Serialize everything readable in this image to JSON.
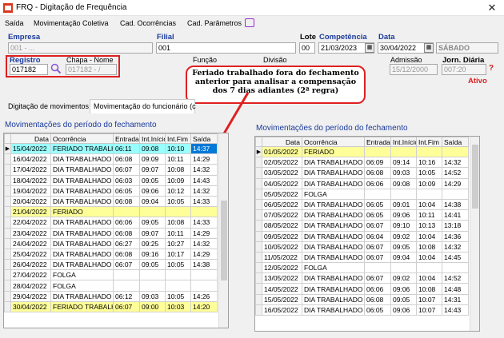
{
  "window": {
    "title": "FRQ - Digitação de Frequência",
    "close": "✕"
  },
  "menu": [
    "Saída",
    "Movimentação Coletiva",
    "Cad. Ocorrências",
    "Cad. Parâmetros"
  ],
  "header": {
    "empresa_label": "Empresa",
    "empresa_value": "001 - ...",
    "filial_label": "Filial",
    "filial_value": "001",
    "lote_label": "Lote",
    "lote_value": "00",
    "competencia_label": "Competência",
    "competencia_value": "21/03/2023",
    "data_label": "Data",
    "data_value": "30/04/2022",
    "dia_semana": "SÁBADO",
    "registro_label": "Registro",
    "registro_value": "017182",
    "chapa_label": "Chapa - Nome",
    "chapa_value": "017182 - /",
    "funcao_label": "Função",
    "divisao_label": "Divisão",
    "admissao_label": "Admissão",
    "admissao_value": "15/12/2000",
    "jornada_label": "Jorn. Diária",
    "jornada_value": "007:20",
    "status": "Ativo",
    "help": "?"
  },
  "tabs": [
    "Digitação de movimentos",
    "Movimentação do funcionário (c"
  ],
  "callout": "Feriado trabalhado fora do fechamento anterior para analisar a compensação dos 7 dias adiantes (2ª regra)",
  "left_grid": {
    "title": "Movimentações do período do fechamento",
    "columns": [
      "Data",
      "Ocorrência",
      "Entrada",
      "Int.Início",
      "Int.Fim",
      "Saída"
    ],
    "rows": [
      {
        "data": "15/04/2022",
        "oc": "FERIADO TRABALH",
        "ent": "06:11",
        "ini": "09:08",
        "fim": "10:10",
        "sai": "14:37",
        "hl": "cyan"
      },
      {
        "data": "16/04/2022",
        "oc": "DIA TRABALHADO",
        "ent": "06:08",
        "ini": "09:09",
        "fim": "10:11",
        "sai": "14:29",
        "hl": ""
      },
      {
        "data": "17/04/2022",
        "oc": "DIA TRABALHADO",
        "ent": "06:07",
        "ini": "09:07",
        "fim": "10:08",
        "sai": "14:32",
        "hl": ""
      },
      {
        "data": "18/04/2022",
        "oc": "DIA TRABALHADO",
        "ent": "06:03",
        "ini": "09:05",
        "fim": "10:09",
        "sai": "14:43",
        "hl": ""
      },
      {
        "data": "19/04/2022",
        "oc": "DIA TRABALHADO",
        "ent": "06:05",
        "ini": "09:06",
        "fim": "10:12",
        "sai": "14:32",
        "hl": ""
      },
      {
        "data": "20/04/2022",
        "oc": "DIA TRABALHADO",
        "ent": "06:08",
        "ini": "09:04",
        "fim": "10:05",
        "sai": "14:33",
        "hl": ""
      },
      {
        "data": "21/04/2022",
        "oc": "FERIADO",
        "ent": "",
        "ini": "",
        "fim": "",
        "sai": "",
        "hl": "yellow"
      },
      {
        "data": "22/04/2022",
        "oc": "DIA TRABALHADO",
        "ent": "06:06",
        "ini": "09:05",
        "fim": "10:08",
        "sai": "14:33",
        "hl": ""
      },
      {
        "data": "23/04/2022",
        "oc": "DIA TRABALHADO",
        "ent": "06:08",
        "ini": "09:07",
        "fim": "10:11",
        "sai": "14:29",
        "hl": ""
      },
      {
        "data": "24/04/2022",
        "oc": "DIA TRABALHADO",
        "ent": "06:27",
        "ini": "09:25",
        "fim": "10:27",
        "sai": "14:32",
        "hl": ""
      },
      {
        "data": "25/04/2022",
        "oc": "DIA TRABALHADO",
        "ent": "06:08",
        "ini": "09:16",
        "fim": "10:17",
        "sai": "14:29",
        "hl": ""
      },
      {
        "data": "26/04/2022",
        "oc": "DIA TRABALHADO",
        "ent": "06:07",
        "ini": "09:05",
        "fim": "10:05",
        "sai": "14:38",
        "hl": ""
      },
      {
        "data": "27/04/2022",
        "oc": "FOLGA",
        "ent": "",
        "ini": "",
        "fim": "",
        "sai": "",
        "hl": ""
      },
      {
        "data": "28/04/2022",
        "oc": "FOLGA",
        "ent": "",
        "ini": "",
        "fim": "",
        "sai": "",
        "hl": ""
      },
      {
        "data": "29/04/2022",
        "oc": "DIA TRABALHADO",
        "ent": "06:12",
        "ini": "09:03",
        "fim": "10:05",
        "sai": "14:26",
        "hl": ""
      },
      {
        "data": "30/04/2022",
        "oc": "FERIADO TRABALH",
        "ent": "06:07",
        "ini": "09:00",
        "fim": "10:03",
        "sai": "14:20",
        "hl": "yellow"
      }
    ]
  },
  "right_grid": {
    "title": "Movimentações do período do fechamento",
    "columns": [
      "Data",
      "Ocorrência",
      "Entrada",
      "Int.Início",
      "Int.Fim",
      "Saída"
    ],
    "rows": [
      {
        "data": "01/05/2022",
        "oc": "FERIADO",
        "ent": "",
        "ini": "",
        "fim": "",
        "sai": "",
        "hl": "yellow"
      },
      {
        "data": "02/05/2022",
        "oc": "DIA TRABALHADO",
        "ent": "06:09",
        "ini": "09:14",
        "fim": "10:16",
        "sai": "14:32",
        "hl": ""
      },
      {
        "data": "03/05/2022",
        "oc": "DIA TRABALHADO",
        "ent": "06:08",
        "ini": "09:03",
        "fim": "10:05",
        "sai": "14:52",
        "hl": ""
      },
      {
        "data": "04/05/2022",
        "oc": "DIA TRABALHADO",
        "ent": "06:06",
        "ini": "09:08",
        "fim": "10:09",
        "sai": "14:29",
        "hl": ""
      },
      {
        "data": "05/05/2022",
        "oc": "FOLGA",
        "ent": "",
        "ini": "",
        "fim": "",
        "sai": "",
        "hl": ""
      },
      {
        "data": "06/05/2022",
        "oc": "DIA TRABALHADO",
        "ent": "06:05",
        "ini": "09:01",
        "fim": "10:04",
        "sai": "14:38",
        "hl": ""
      },
      {
        "data": "07/05/2022",
        "oc": "DIA TRABALHADO",
        "ent": "06:05",
        "ini": "09:06",
        "fim": "10:11",
        "sai": "14:41",
        "hl": ""
      },
      {
        "data": "08/05/2022",
        "oc": "DIA TRABALHADO",
        "ent": "06:07",
        "ini": "09:10",
        "fim": "10:13",
        "sai": "13:18",
        "hl": ""
      },
      {
        "data": "09/05/2022",
        "oc": "DIA TRABALHADO",
        "ent": "06:04",
        "ini": "09:02",
        "fim": "10:04",
        "sai": "14:36",
        "hl": ""
      },
      {
        "data": "10/05/2022",
        "oc": "DIA TRABALHADO",
        "ent": "06:07",
        "ini": "09:05",
        "fim": "10:08",
        "sai": "14:32",
        "hl": ""
      },
      {
        "data": "11/05/2022",
        "oc": "DIA TRABALHADO",
        "ent": "06:07",
        "ini": "09:04",
        "fim": "10:04",
        "sai": "14:45",
        "hl": ""
      },
      {
        "data": "12/05/2022",
        "oc": "FOLGA",
        "ent": "",
        "ini": "",
        "fim": "",
        "sai": "",
        "hl": ""
      },
      {
        "data": "13/05/2022",
        "oc": "DIA TRABALHADO",
        "ent": "06:07",
        "ini": "09:02",
        "fim": "10:04",
        "sai": "14:52",
        "hl": ""
      },
      {
        "data": "14/05/2022",
        "oc": "DIA TRABALHADO",
        "ent": "06:06",
        "ini": "09:06",
        "fim": "10:08",
        "sai": "14:48",
        "hl": ""
      },
      {
        "data": "15/05/2022",
        "oc": "DIA TRABALHADO",
        "ent": "06:08",
        "ini": "09:05",
        "fim": "10:07",
        "sai": "14:31",
        "hl": ""
      },
      {
        "data": "16/05/2022",
        "oc": "DIA TRABALHADO",
        "ent": "06:05",
        "ini": "09:06",
        "fim": "10:07",
        "sai": "14:43",
        "hl": ""
      }
    ]
  }
}
